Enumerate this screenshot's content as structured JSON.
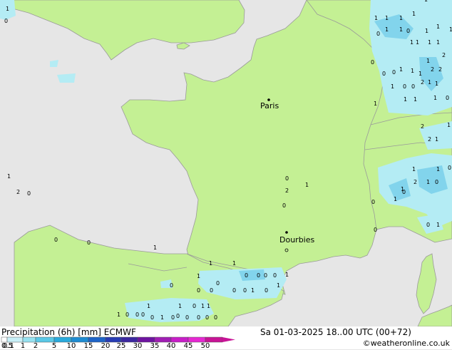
{
  "legend": {
    "title": "Precipitation (6h) [mm] ECMWF",
    "ticks": [
      "0.1",
      "0.5",
      "1",
      "2",
      "5",
      "10",
      "15",
      "20",
      "25",
      "30",
      "35",
      "40",
      "45",
      "50"
    ],
    "colors": [
      "#ffffff",
      "#c8f0f8",
      "#96e1f0",
      "#5ac8e6",
      "#2aaadc",
      "#1e8cd2",
      "#1e64c8",
      "#283cb4",
      "#3c28a0",
      "#6e14a0",
      "#a01eb4",
      "#c81ec8",
      "#e628d2",
      "#c81496"
    ]
  },
  "datetime": "Sa 01-03-2025 18..00 UTC (00+72)",
  "credit": "©weatheronline.co.uk",
  "cities": [
    {
      "name": "Paris"
    },
    {
      "name": "Dourbies"
    }
  ],
  "colors": {
    "land": "#c4f094",
    "sea": "#e6e6e6",
    "border": "#9a9a9a",
    "light_precip": "#b4ecf4",
    "med_precip": "#82d4ec"
  },
  "precip_values": [
    {
      "v": "1"
    },
    {
      "v": "0"
    },
    {
      "v": "1"
    },
    {
      "v": "1"
    },
    {
      "v": "1"
    },
    {
      "v": "1"
    },
    {
      "v": "1"
    },
    {
      "v": "1"
    },
    {
      "v": "1"
    },
    {
      "v": "0"
    },
    {
      "v": "1"
    },
    {
      "v": "0"
    },
    {
      "v": "1"
    },
    {
      "v": "1"
    },
    {
      "v": "1"
    },
    {
      "v": "1"
    },
    {
      "v": "1"
    },
    {
      "v": "1"
    },
    {
      "v": "2"
    },
    {
      "v": "1"
    },
    {
      "v": "0"
    },
    {
      "v": "0"
    },
    {
      "v": "0"
    },
    {
      "v": "2"
    },
    {
      "v": "2"
    },
    {
      "v": "1"
    },
    {
      "v": "1"
    },
    {
      "v": "1"
    },
    {
      "v": "2"
    },
    {
      "v": "1"
    },
    {
      "v": "1"
    },
    {
      "v": "1"
    },
    {
      "v": "0"
    },
    {
      "v": "0"
    },
    {
      "v": "1"
    },
    {
      "v": "1"
    },
    {
      "v": "1"
    },
    {
      "v": "0"
    },
    {
      "v": "1"
    },
    {
      "v": "2"
    },
    {
      "v": "1"
    },
    {
      "v": "2"
    },
    {
      "v": "1"
    },
    {
      "v": "1"
    },
    {
      "v": "1"
    },
    {
      "v": "2"
    },
    {
      "v": "1"
    },
    {
      "v": "0"
    },
    {
      "v": "0"
    },
    {
      "v": "1"
    },
    {
      "v": "1"
    },
    {
      "v": "0"
    },
    {
      "v": "0"
    },
    {
      "v": "0"
    },
    {
      "v": "0"
    },
    {
      "v": "1"
    },
    {
      "v": "1"
    },
    {
      "v": "2"
    },
    {
      "v": "0"
    },
    {
      "v": "0"
    },
    {
      "v": "0"
    },
    {
      "v": "1"
    },
    {
      "v": "1"
    },
    {
      "v": "1"
    },
    {
      "v": "1"
    },
    {
      "v": "0"
    },
    {
      "v": "0"
    },
    {
      "v": "0"
    },
    {
      "v": "0"
    },
    {
      "v": "1"
    },
    {
      "v": "1"
    },
    {
      "v": "1"
    },
    {
      "v": "0"
    },
    {
      "v": "0"
    },
    {
      "v": "0"
    },
    {
      "v": "0"
    },
    {
      "v": "0"
    },
    {
      "v": "0"
    },
    {
      "v": "1"
    },
    {
      "v": "0"
    },
    {
      "v": "0"
    },
    {
      "v": "1"
    },
    {
      "v": "1"
    },
    {
      "v": "0"
    },
    {
      "v": "0"
    },
    {
      "v": "0"
    },
    {
      "v": "0"
    },
    {
      "v": "0"
    },
    {
      "v": "0"
    },
    {
      "v": "2"
    },
    {
      "v": "1"
    },
    {
      "v": "0"
    },
    {
      "v": "0"
    },
    {
      "v": "0"
    },
    {
      "v": "0"
    },
    {
      "v": "1"
    },
    {
      "v": "0"
    },
    {
      "v": "1"
    },
    {
      "v": "0"
    },
    {
      "v": "1"
    }
  ]
}
